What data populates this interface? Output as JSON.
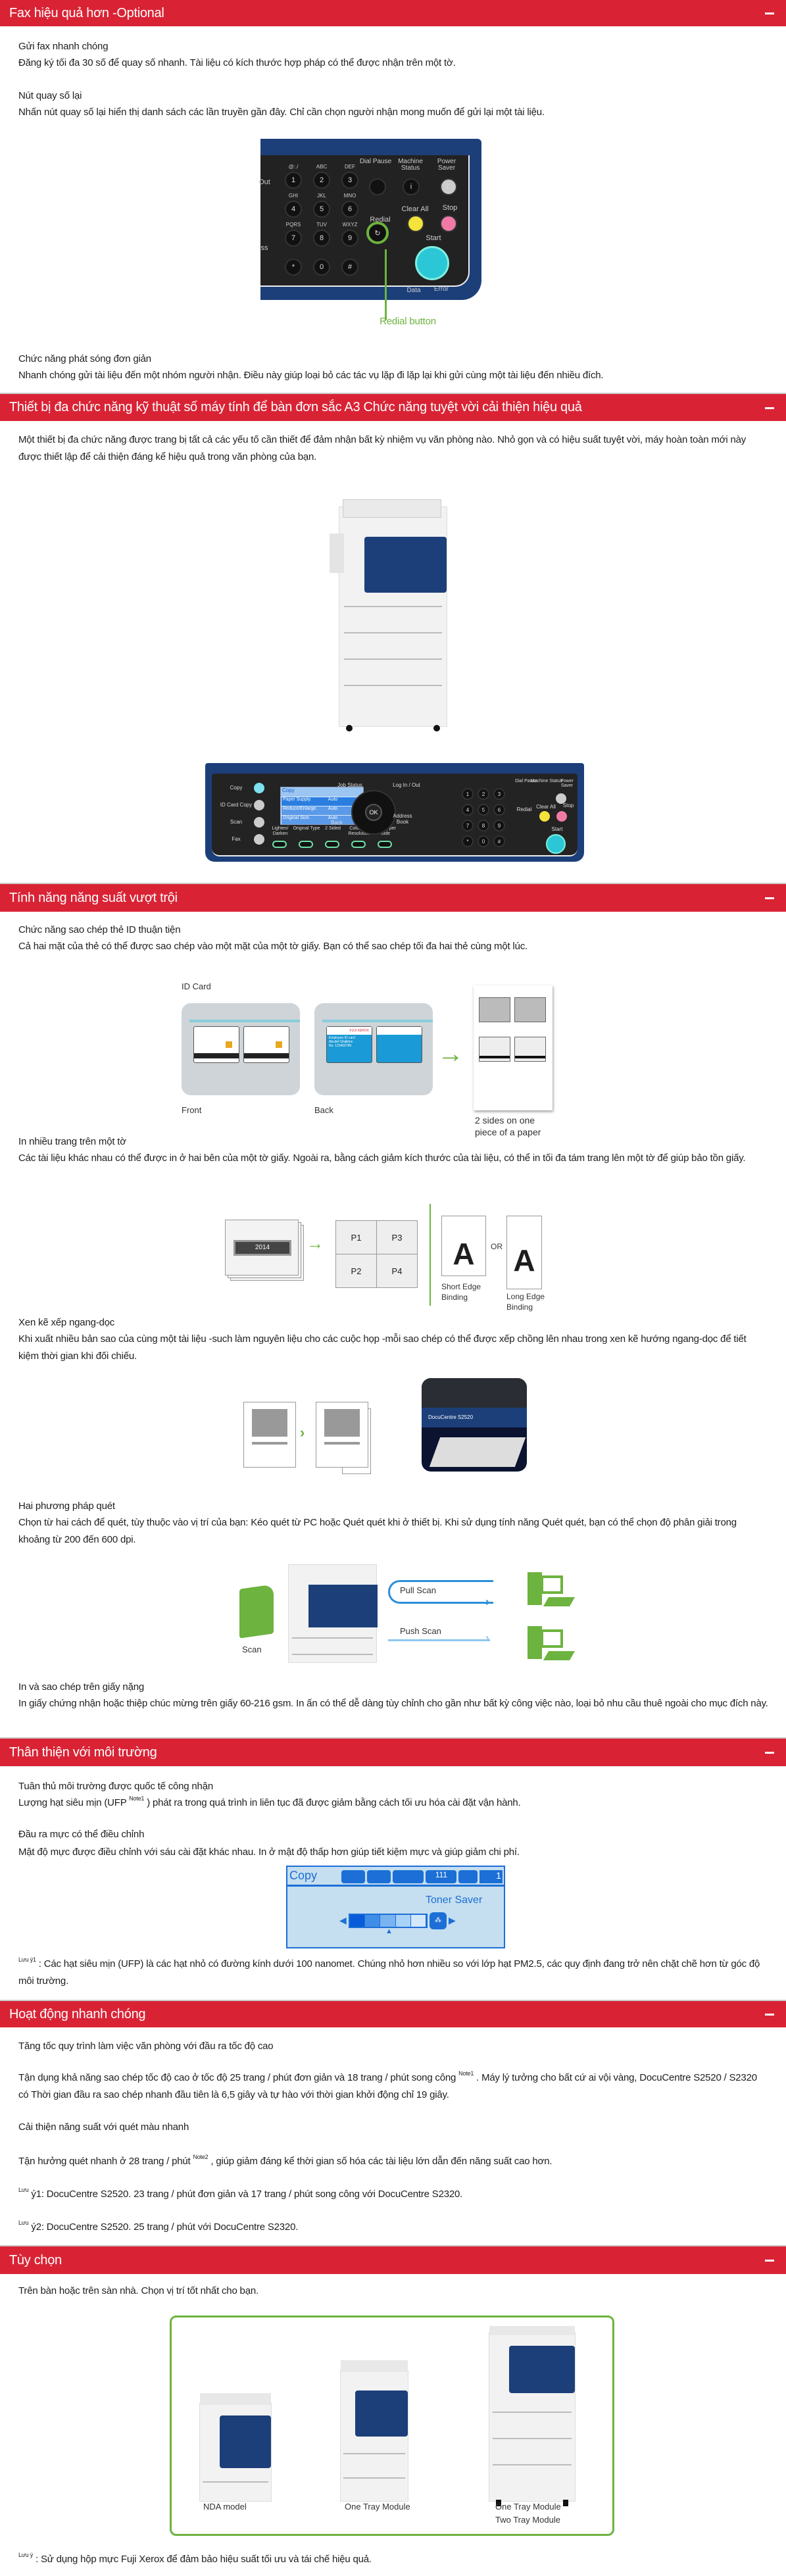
{
  "colors": {
    "header_red": "#d92335",
    "accent_green": "#6db33f",
    "panel_navy": "#1c3f7a"
  },
  "sections": [
    {
      "title": "Fax hiệu quả hơn -Optional",
      "toggle_icon": "minus-icon",
      "items": [
        {
          "title": "Gửi fax nhanh chóng",
          "desc": "Đăng ký tối đa 30 số để quay số nhanh. Tài liệu có kích thước hợp pháp có thể được nhận trên một tờ."
        },
        {
          "title": "Nút quay số lại",
          "desc": "Nhấn nút quay số lại hiển thị danh sách các lần truyền gần đây. Chỉ cần chọn người nhận mong muốn để gửi lại một tài liệu."
        },
        {
          "title": "Chức năng phát sóng đơn giản",
          "desc": "Nhanh chóng gửi tài liệu đến một nhóm người nhận. Điều này giúp loại bỏ các tác vụ lặp đi lặp lại khi gửi cùng một tài liệu đến nhiều đích."
        }
      ],
      "figure": {
        "callout": "Redial button",
        "keys": [
          "1",
          "2",
          "3",
          "4",
          "5",
          "6",
          "7",
          "8",
          "9",
          "*",
          "0",
          "#"
        ],
        "key_letters": [
          "@:./",
          "ABC",
          "DEF",
          "GHI",
          "JKL",
          "MNO",
          "PQRS",
          "TUV",
          "WXYZ"
        ],
        "dial_pause": "Dial Pause",
        "machine_status": "Machine Status",
        "power_saver": "Power Saver",
        "clear_all": "Clear All",
        "stop": "Stop",
        "redial": "Redial",
        "start": "Start",
        "data": "Data",
        "error": "Error",
        "out": "Out",
        "ss": "ss"
      }
    },
    {
      "title": "Thiết bị đa chức năng kỹ thuật số máy tính để bàn đơn sắc A3 Chức năng tuyệt vời cải thiện hiệu quả",
      "toggle_icon": "minus-icon",
      "desc": "Một thiết bị đa chức năng được trang bị tất cả các yếu tố cần thiết để đảm nhận bất kỳ nhiệm vụ văn phòng nào. Nhỏ gọn và có hiệu suất tuyệt vời, máy hoàn toàn mới này được thiết lập để cải thiện đáng kể hiệu quả trong văn phòng của bạn.",
      "panel": {
        "mode_buttons": [
          "Copy",
          "ID Card Copy",
          "Scan",
          "Fax"
        ],
        "lcd_title": "Copy",
        "lcd_rows": [
          [
            "Paper Supply.",
            "Auto"
          ],
          [
            "Reduce/Enlarge.",
            "Auto"
          ],
          [
            "Original Size.",
            "Auto"
          ]
        ],
        "bottom_buttons": [
          "Lighten/ Darken",
          "Original Type",
          "2 Sided",
          "Collated / Resolution",
          "Pages per Side"
        ],
        "job_status": "Job Status",
        "log_in_out": "Log In / Out",
        "ok": "OK",
        "back": "Back",
        "address_book": "Address Book",
        "redial": "Redial",
        "clear_all": "Clear All",
        "stop": "Stop",
        "start": "Start",
        "dial_pause": "Dial Pause",
        "machine_status": "Machine Status",
        "power_saver": "Power Saver",
        "data_error": "Data Error"
      }
    },
    {
      "title": "Tính năng năng suất vượt trội",
      "toggle_icon": "minus-icon",
      "items": [
        {
          "title": "Chức năng sao chép thẻ ID thuận tiện",
          "desc": "Cả hai mặt của thẻ có thể được sao chép vào một mặt của một tờ giấy. Bạn có thể sao chép tối đa hai thẻ cùng một lúc."
        },
        {
          "title": "In nhiều trang trên một tờ",
          "desc": "Các tài liệu khác nhau có thể được in ở hai bên của một tờ giấy. Ngoài ra, bằng cách giảm kích thước của tài liệu, có thể in tối đa tám trang lên một tờ để giúp bảo tồn giấy."
        },
        {
          "title": "Xen kẽ xếp ngang-dọc",
          "desc": "Khi xuất nhiều bản sao của cùng một tài liệu -such làm nguyên liệu cho các cuộc họp -mỗi sao chép có thể được xếp chồng lên nhau trong xen kẽ hướng ngang-dọc để tiết kiệm thời gian khi đối chiếu."
        },
        {
          "title": "Hai phương pháp quét",
          "desc": "Chọn từ hai cách để quét, tùy thuộc vào vị trí của bạn: Kéo quét từ PC hoặc Quét quét khi ở thiết bị. Khi sử dụng tính năng Quét quét, bạn có thể chọn độ phân giải trong khoảng từ 200 đến 600 dpi."
        },
        {
          "title": "In và sao chép trên giấy nặng",
          "desc": "In giấy chứng nhận hoặc thiệp chúc mừng trên giấy 60-216 gsm. In ấn có thể dễ dàng tùy chỉnh cho gần như bất kỳ công việc nào, loại bỏ nhu cầu thuê ngoài cho mục đích này."
        }
      ],
      "idcard": {
        "title": "ID Card",
        "front": "Front",
        "back": "Back",
        "result": "2 sides on one piece of a paper",
        "card_brand": "FUJI XEROX",
        "card_text": "Employee ID card",
        "card_name": "Abcdef Ghijklmn",
        "card_no": "No. 123456789"
      },
      "nup": {
        "cover": "2014",
        "pages": [
          "P1",
          "P2",
          "P3",
          "P4"
        ],
        "or": "OR",
        "short_edge": "Short Edge Binding",
        "long_edge": "Long Edge Binding",
        "letter": "A"
      },
      "collate": {
        "model": "DocuCentre S2520"
      },
      "scan": {
        "scan": "Scan",
        "pull": "Pull Scan",
        "push": "Push Scan"
      }
    },
    {
      "title": "Thân thiện với môi trường",
      "toggle_icon": "minus-icon",
      "items": [
        {
          "title": "Tuân thủ môi trường được quốc tế công nhận",
          "desc_a": "Lượng hạt siêu mịn (UFP ",
          "sup": "Note1",
          "desc_b": " ) phát ra trong quá trình in liên tục đã được giảm bằng cách tối ưu hóa cài đặt vận hành."
        },
        {
          "title": "Đầu ra mực có thể điều chỉnh",
          "desc": "Mật độ mực được điều chỉnh với sáu cài đặt khác nhau. In ở mật độ thấp hơn giúp tiết kiệm mực và giúp giảm chi phí."
        }
      ],
      "toner": {
        "mode": "Copy",
        "label": "Toner Saver",
        "count": "1",
        "copies": "111",
        "level": 3,
        "levels": 5
      },
      "note": {
        "sup": "Lưu ý1",
        "text": " : Các hạt siêu mịn (UFP) là các hạt nhỏ có đường kính dưới 100 nanomet. Chúng nhỏ hơn nhiều so với lớp hạt PM2.5, các quy định đang trở nên chặt chẽ hơn từ góc độ môi trường."
      }
    },
    {
      "title": "Hoạt động nhanh chóng",
      "toggle_icon": "minus-icon",
      "heading": "Tăng tốc quy trình làm việc văn phòng với đầu ra tốc độ cao",
      "p1_a": "Tận dụng khả năng sao chép tốc độ cao ở tốc độ 25 trang / phút đơn giản và 18 trang / phút song công ",
      "p1_sup": "Note1",
      "p1_b": " . Máy lý tưởng cho bất cứ ai vội vàng, DocuCentre S2520 / S2320 có Thời gian đầu ra sao chép nhanh đầu tiên là 6,5 giây và tự hào với thời gian khởi động chỉ 19 giây.",
      "heading2": "Cải thiện năng suất với quét màu nhanh",
      "p2_a": "Tận hưởng quét nhanh ở 28 trang / phút ",
      "p2_sup": "Note2",
      "p2_b": " , giúp giảm đáng kể thời gian số hóa các tài liệu lớn dẫn đến năng suất cao hơn.",
      "note1_sup": "Lưu",
      "note1": " ý1: DocuCentre S2520. 23 trang / phút đơn giản và 17 trang / phút song công với DocuCentre S2320.",
      "note2_sup": "Lưu",
      "note2": " ý2: DocuCentre S2520. 25 trang / phút với DocuCentre S2320."
    },
    {
      "title": "Tùy chọn",
      "toggle_icon": "minus-icon",
      "desc": "Trên bàn hoặc trên sàn nhà. Chọn vị trí tốt nhất cho bạn.",
      "options": [
        "NDA model",
        "One Tray Module",
        "One Tray Module",
        "Two Tray Module"
      ],
      "note_sup": "Lưu ý",
      "note": " : Sử dụng hộp mực Fuji Xerox để đảm bảo hiệu suất tối ưu và tái chế hiệu quả."
    }
  ]
}
